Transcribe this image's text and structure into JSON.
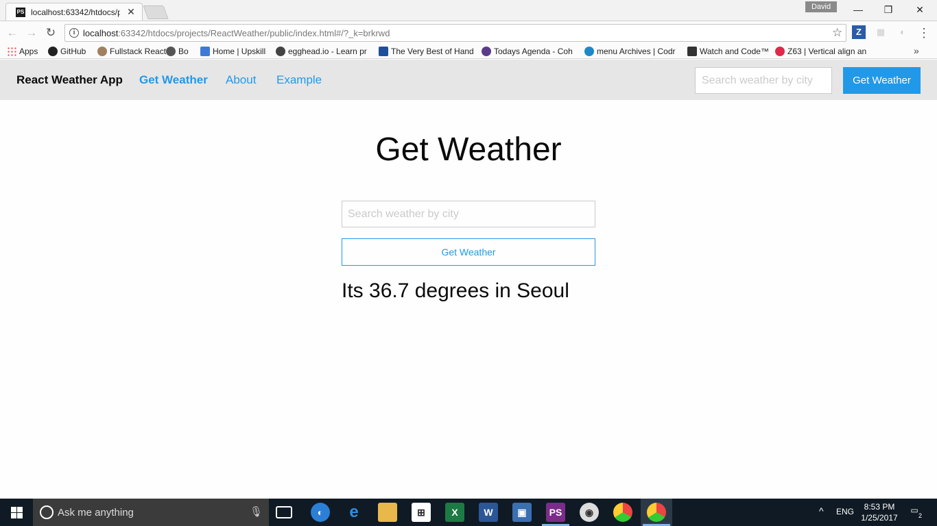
{
  "browser": {
    "tab_title": "localhost:63342/htdocs/p",
    "tab_favicon": "PS",
    "profile_name": "David",
    "url_host": "localhost",
    "url_rest": ":63342/htdocs/projects/ReactWeather/public/index.html#/?_k=brkrwd",
    "ext_z": "Z",
    "bookmarks": [
      {
        "label": "Apps",
        "icon": "apps-grid-icon"
      },
      {
        "label": "GitHub",
        "icon": "github-icon"
      },
      {
        "label": "Fullstack React",
        "icon": "fullstack-icon"
      },
      {
        "label": "Bo",
        "icon": "bo-icon"
      },
      {
        "label": "Home | Upskill",
        "icon": "upskill-icon"
      },
      {
        "label": "egghead.io - Learn pr",
        "icon": "egghead-icon"
      },
      {
        "label": "The Very Best of Hand",
        "icon": "h-icon"
      },
      {
        "label": "Todays Agenda - Coh",
        "icon": "agenda-icon"
      },
      {
        "label": "menu Archives | Codr",
        "icon": "codrops-icon"
      },
      {
        "label": "Watch and Code™",
        "icon": "w-icon"
      },
      {
        "label": "Z63 | Vertical align an",
        "icon": "z63-icon"
      }
    ]
  },
  "app": {
    "brand": "React Weather App",
    "nav": {
      "get_weather": "Get Weather",
      "about": "About",
      "example": "Example"
    },
    "nav_search_placeholder": "Search weather by city",
    "nav_button": "Get Weather",
    "main": {
      "title": "Get Weather",
      "input_placeholder": "Search weather by city",
      "button": "Get Weather",
      "result": "Its 36.7 degrees in Seoul"
    },
    "accent_color": "#2199e8"
  },
  "taskbar": {
    "search_placeholder": "Ask me anything",
    "language": "ENG",
    "time": "8:53 PM",
    "date": "1/25/2017",
    "notifications": "2"
  }
}
